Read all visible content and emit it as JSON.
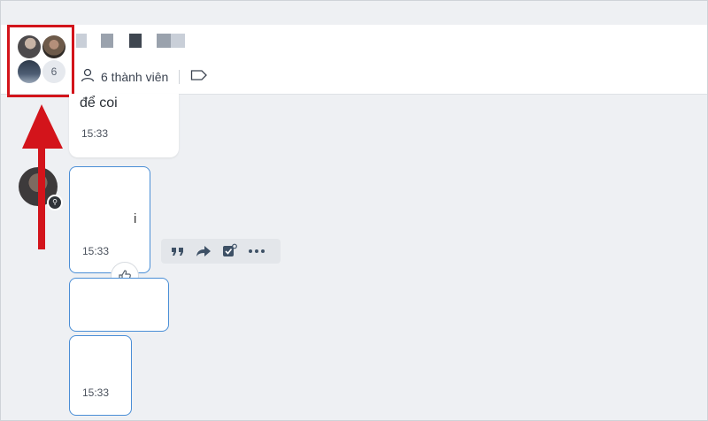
{
  "header": {
    "member_count_badge": "6",
    "member_label": "6 thành viên"
  },
  "messages": [
    {
      "text": "để coi",
      "time": "15:33"
    },
    {
      "text": "i",
      "time": "15:33"
    },
    {
      "text": "",
      "time": ""
    },
    {
      "text": "",
      "time": "15:33"
    }
  ],
  "icons": {
    "members": "person-icon",
    "tag": "tag-icon",
    "reaction": "thumbs-up-icon",
    "quote": "quote-icon",
    "forward": "forward-icon",
    "task": "task-check-icon",
    "more": "more-icon"
  },
  "colors": {
    "annotation": "#d3141b",
    "selection": "#4a8ed6",
    "action_icon": "#3e5166"
  }
}
